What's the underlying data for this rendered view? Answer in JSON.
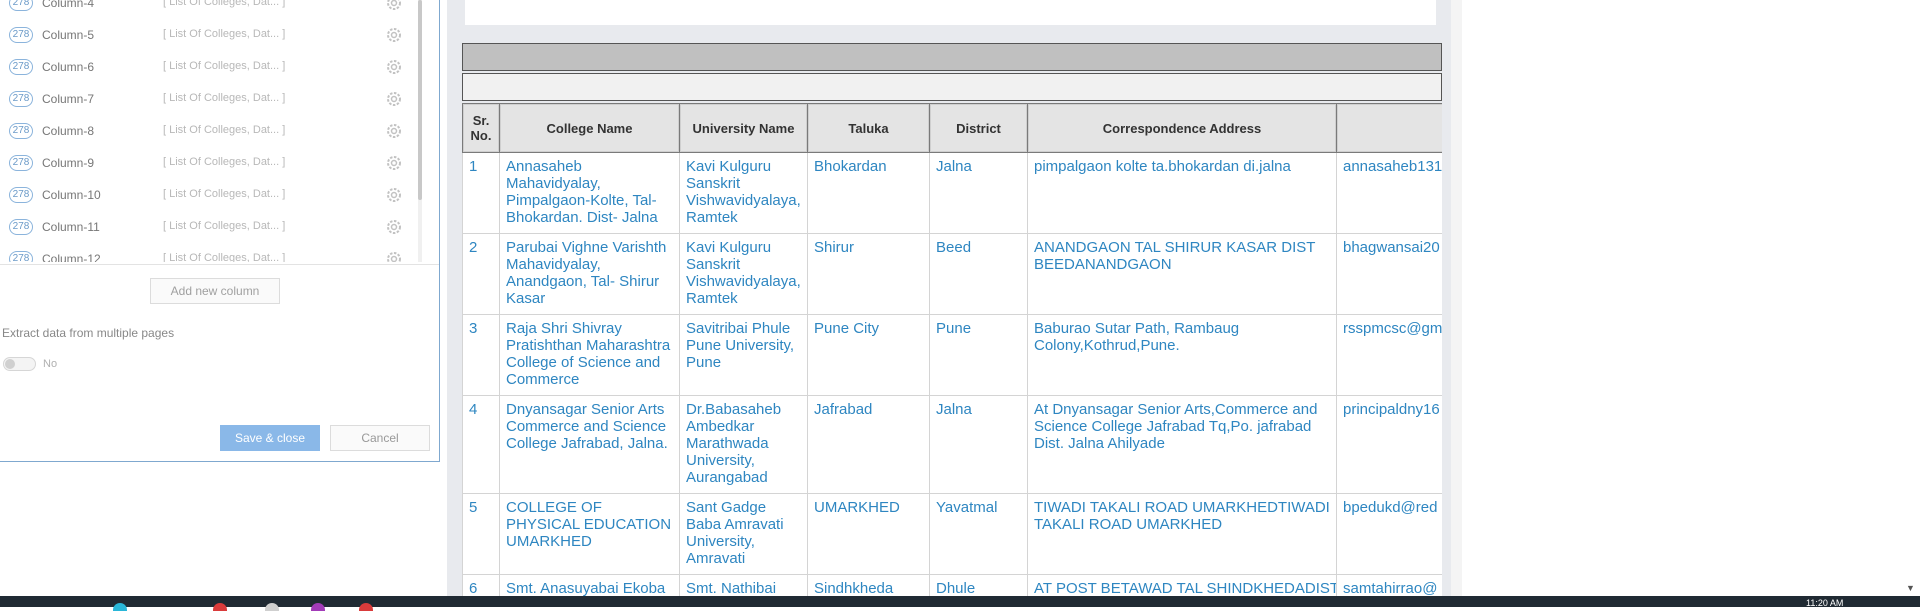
{
  "columns_panel": {
    "rows": [
      {
        "count": "278",
        "name": "Column-4",
        "source": "[ List Of Colleges, Dat... ]"
      },
      {
        "count": "278",
        "name": "Column-5",
        "source": "[ List Of Colleges, Dat... ]"
      },
      {
        "count": "278",
        "name": "Column-6",
        "source": "[ List Of Colleges, Dat... ]"
      },
      {
        "count": "278",
        "name": "Column-7",
        "source": "[ List Of Colleges, Dat... ]"
      },
      {
        "count": "278",
        "name": "Column-8",
        "source": "[ List Of Colleges, Dat... ]"
      },
      {
        "count": "278",
        "name": "Column-9",
        "source": "[ List Of Colleges, Dat... ]"
      },
      {
        "count": "278",
        "name": "Column-10",
        "source": "[ List Of Colleges, Dat... ]"
      },
      {
        "count": "278",
        "name": "Column-11",
        "source": "[ List Of Colleges, Dat... ]"
      },
      {
        "count": "278",
        "name": "Column-12",
        "source": "[ List Of Colleges, Dat... ]"
      }
    ],
    "add_column_label": "Add new column",
    "extract_label": "Extract data from multiple pages",
    "toggle_label": "No",
    "save_label": "Save & close",
    "cancel_label": "Cancel"
  },
  "table": {
    "headers": [
      "Sr. No.",
      "College Name",
      "University Name",
      "Taluka",
      "District",
      "Correspondence Address",
      ""
    ],
    "rows": [
      [
        "1",
        "Annasaheb Mahavidyalay, Pimpalgaon-Kolte, Tal- Bhokardan. Dist- Jalna",
        "Kavi Kulguru Sanskrit Vishwavidyalaya, Ramtek",
        "Bhokardan",
        "Jalna",
        "pimpalgaon kolte ta.bhokardan di.jalna",
        "annasaheb131"
      ],
      [
        "2",
        "Parubai Vighne Varishth Mahavidyalay, Anandgaon, Tal- Shirur Kasar",
        "Kavi Kulguru Sanskrit Vishwavidyalaya, Ramtek",
        "Shirur",
        "Beed",
        "ANANDGAON TAL SHIRUR KASAR DIST BEEDANANDGAON",
        "bhagwansai20"
      ],
      [
        "3",
        "Raja Shri Shivray Pratishthan Maharashtra College of Science and Commerce",
        "Savitribai Phule Pune University, Pune",
        "Pune City",
        "Pune",
        "Baburao Sutar Path, Rambaug Colony,Kothrud,Pune.",
        "rsspmcsc@gm"
      ],
      [
        "4",
        "Dnyansagar Senior Arts Commerce and Science College Jafrabad, Jalna.",
        "Dr.Babasaheb Ambedkar Marathwada University, Aurangabad",
        "Jafrabad",
        "Jalna",
        "At Dnyansagar Senior Arts,Commerce and Science College Jafrabad Tq,Po. jafrabad Dist. Jalna Ahilyade",
        "principaldny16"
      ],
      [
        "5",
        "COLLEGE OF PHYSICAL EDUCATION UMARKHED",
        "Sant Gadge Baba Amravati University, Amravati",
        "UMARKHED",
        "Yavatmal",
        "TIWADI TAKALI ROAD UMARKHEDTIWADI TAKALI ROAD UMARKHED",
        "bpedukd@red"
      ],
      [
        "6",
        "Smt. Anasuyabai Ekoba",
        "Smt. Nathibai",
        "Sindhkheda",
        "Dhule",
        "AT POST BETAWAD TAL SHINDKHEDADIST",
        "samtahirrao@"
      ]
    ]
  },
  "taskbar": {
    "clock": "11:20 AM"
  },
  "colors": {
    "link_text": "#2e86c1",
    "save_button": "#8ab8e8",
    "badge": "#6b9ac8",
    "taskbar": "#202a33"
  },
  "icons": {
    "settings": "gear-icon"
  }
}
